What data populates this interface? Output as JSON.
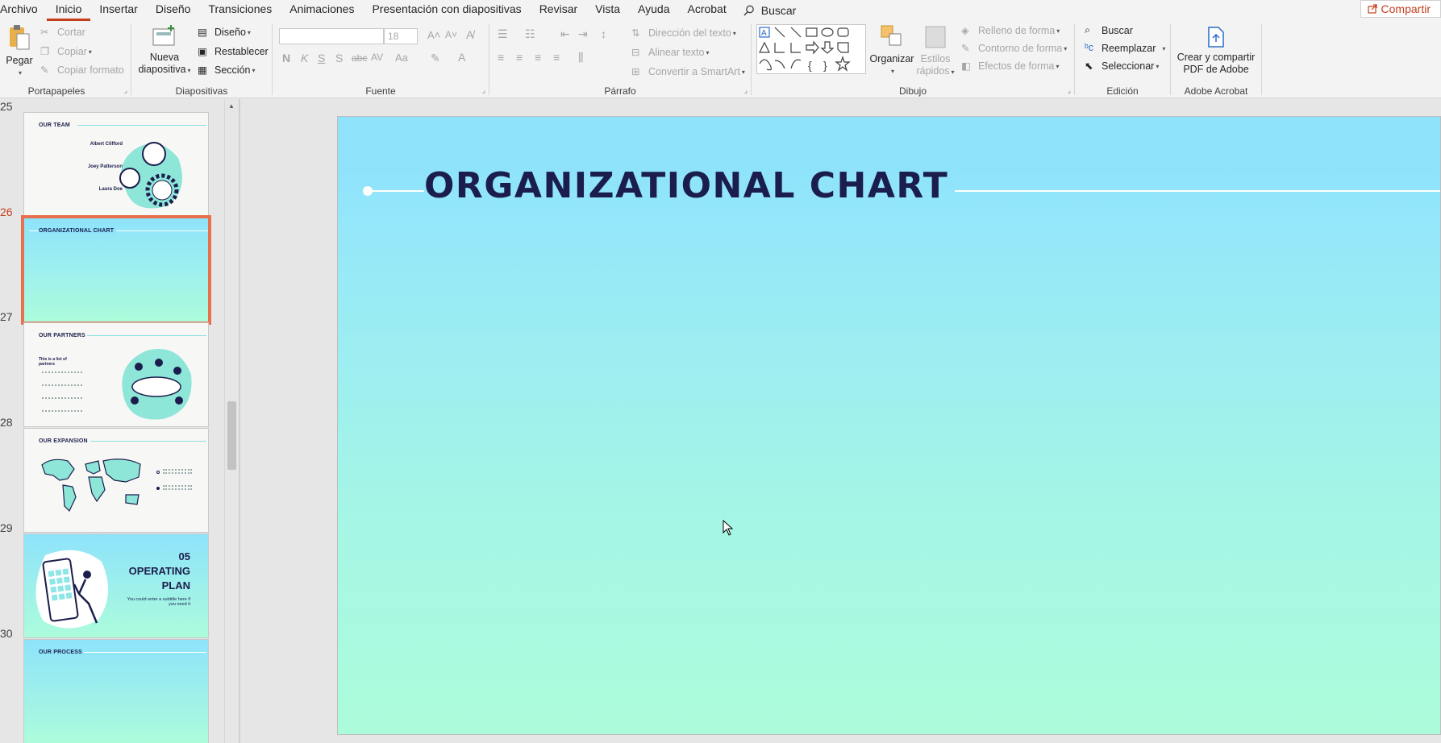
{
  "tabs": [
    "Archivo",
    "Inicio",
    "Insertar",
    "Diseño",
    "Transiciones",
    "Animaciones",
    "Presentación con diapositivas",
    "Revisar",
    "Vista",
    "Ayuda",
    "Acrobat"
  ],
  "active_tab": "Inicio",
  "tell_me": "Buscar",
  "share": "Compartir",
  "ribbon": {
    "clipboard": {
      "paste": "Pegar",
      "cut": "Cortar",
      "copy": "Copiar",
      "format_painter": "Copiar formato",
      "label": "Portapapeles"
    },
    "slides": {
      "new_slide_1": "Nueva",
      "new_slide_2": "diapositiva",
      "layout": "Diseño",
      "reset": "Restablecer",
      "section": "Sección",
      "label": "Diapositivas"
    },
    "font": {
      "size": "18",
      "bold": "N",
      "italic": "K",
      "underline": "S",
      "shadow": "S",
      "strike": "abc",
      "label": "Fuente"
    },
    "paragraph": {
      "text_direction": "Dirección del texto",
      "align_text": "Alinear texto",
      "smartart": "Convertir a SmartArt",
      "label": "Párrafo"
    },
    "drawing": {
      "arrange": "Organizar",
      "quick_styles_1": "Estilos",
      "quick_styles_2": "rápidos",
      "shape_fill": "Relleno de forma",
      "shape_outline": "Contorno de forma",
      "shape_effects": "Efectos de forma",
      "label": "Dibujo"
    },
    "editing": {
      "find": "Buscar",
      "replace": "Reemplazar",
      "select": "Seleccionar",
      "label": "Edición"
    },
    "acrobat": {
      "create_1": "Crear y compartir",
      "create_2": "PDF de Adobe",
      "label": "Adobe Acrobat"
    }
  },
  "thumbnails": [
    {
      "num": "25",
      "title": "OUR TEAM",
      "names": [
        "Albert Clifford",
        "Joey Patterson",
        "Laura Doe"
      ]
    },
    {
      "num": "26",
      "title": "ORGANIZATIONAL CHART"
    },
    {
      "num": "27",
      "title": "OUR PARTNERS",
      "subtitle": "This is a list of partners"
    },
    {
      "num": "28",
      "title": "OUR EXPANSION"
    },
    {
      "num": "29",
      "title_lines": [
        "05",
        "OPERATING",
        "PLAN"
      ],
      "subtitle": "You could enter a subtitle here if you need it"
    },
    {
      "num": "30",
      "title": "OUR PROCESS"
    }
  ],
  "active_slide": "26",
  "slide": {
    "title": "ORGANIZATIONAL CHART"
  },
  "colors": {
    "accent": "#c43e1c",
    "slide_title": "#1b1d4c",
    "thumb_selected": "#e8704e"
  }
}
